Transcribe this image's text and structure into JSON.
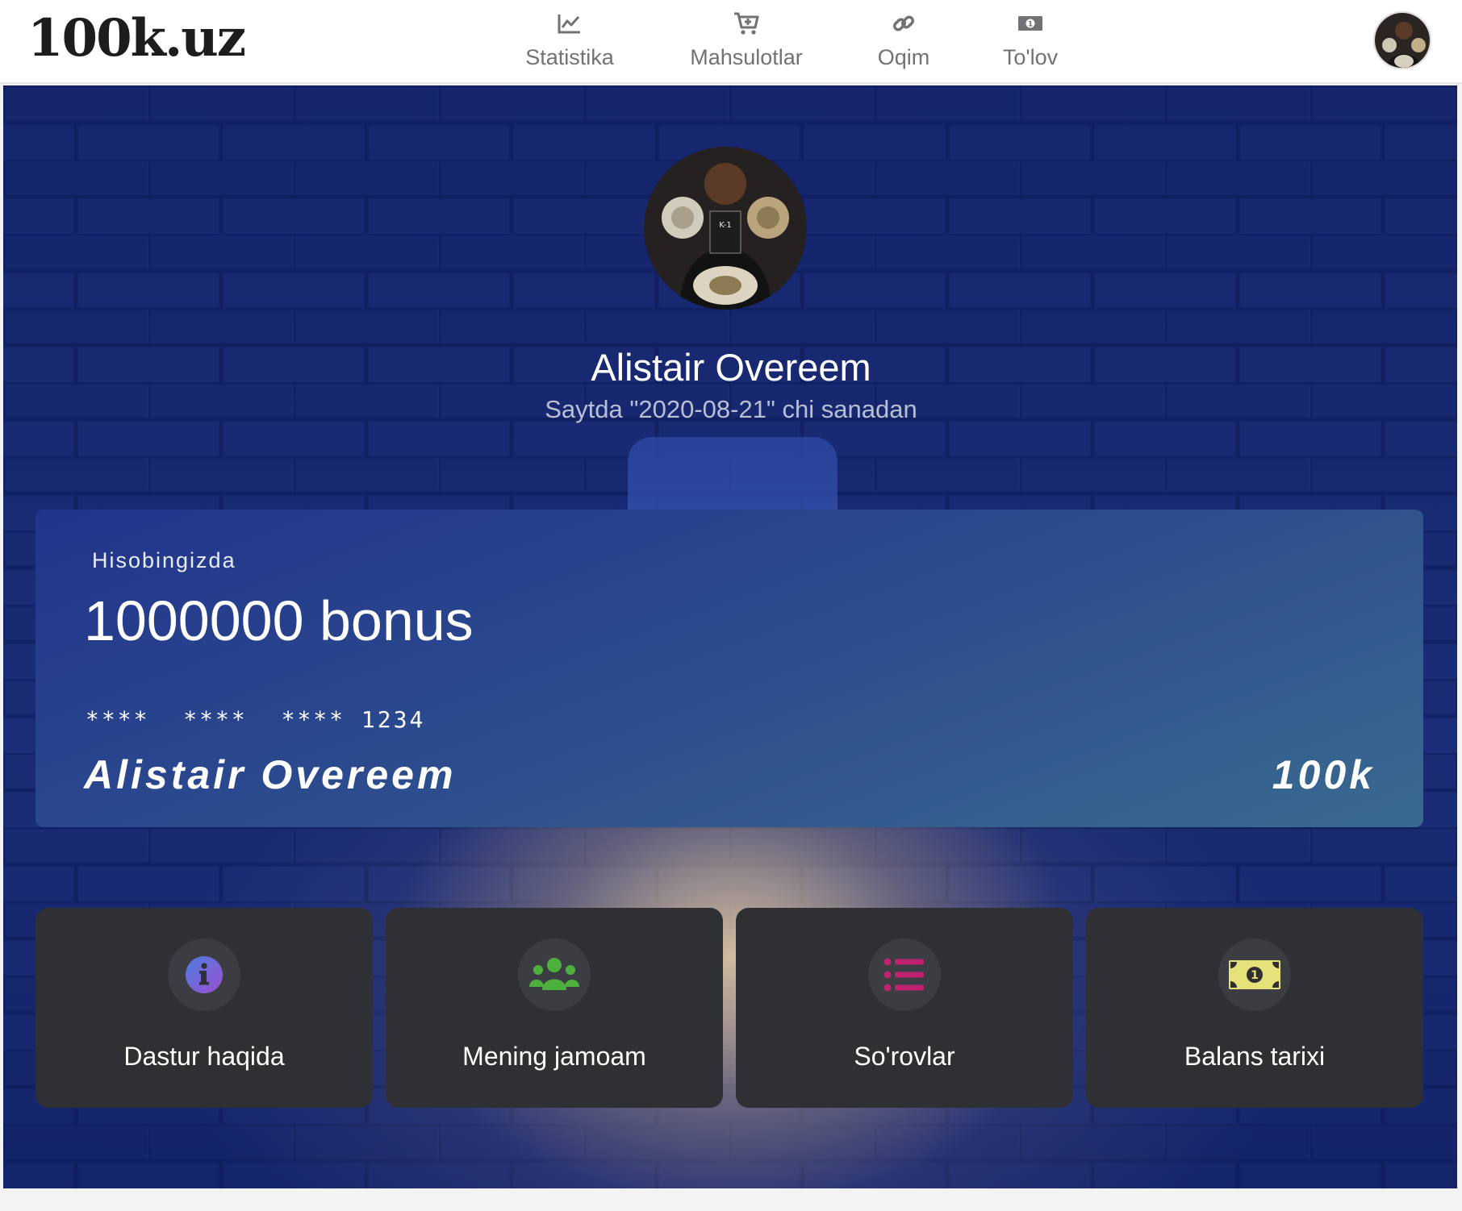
{
  "header": {
    "logo": "100k.uz",
    "nav": [
      {
        "label": "Statistika",
        "icon": "chart-line-icon"
      },
      {
        "label": "Mahsulotlar",
        "icon": "cart-plus-icon"
      },
      {
        "label": "Oqim",
        "icon": "link-icon"
      },
      {
        "label": "To'lov",
        "icon": "money-bill-icon"
      }
    ],
    "avatar_icon": "user-avatar"
  },
  "profile": {
    "name": "Alistair Overeem",
    "since": "Saytda \"2020-08-21\" chi sanadan"
  },
  "card": {
    "label": "Hisobingizda",
    "balance": "1000000 bonus",
    "number_groups": [
      "****",
      "****",
      "**** 1234"
    ],
    "holder": "Alistair Overeem",
    "brand": "100k"
  },
  "tiles": [
    {
      "label": "Dastur haqida",
      "icon": "info-circle-icon",
      "color": "#7b5fd6"
    },
    {
      "label": "Mening jamoam",
      "icon": "users-icon",
      "color": "#4caf3e"
    },
    {
      "label": "So'rovlar",
      "icon": "list-icon",
      "color": "#c0226e"
    },
    {
      "label": "Balans tarixi",
      "icon": "money-bill-icon",
      "color": "#e6e27a"
    }
  ],
  "colors": {
    "nav_text": "#707276",
    "card_gradient_start": "#22348b",
    "card_gradient_end": "#3a6a8f",
    "tile_bg": "#2e3034"
  }
}
